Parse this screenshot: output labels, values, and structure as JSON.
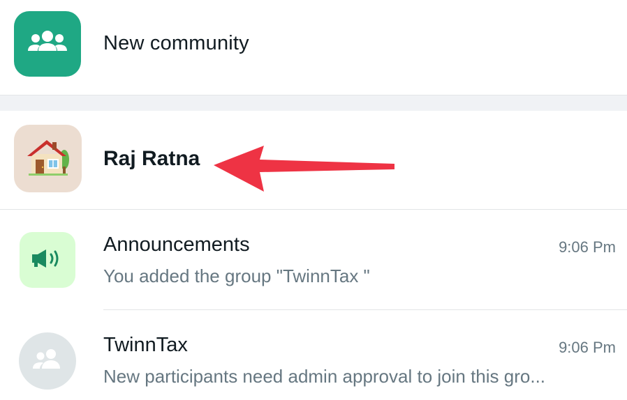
{
  "new_community": {
    "label": "New community",
    "icon": "community-group-icon",
    "tile_color": "#1fa884"
  },
  "community": {
    "name": "Raj Ratna",
    "icon": "house-emoji-icon",
    "tile_color": "#ecddd1",
    "annotation_color": "#ee3344"
  },
  "chats": [
    {
      "name": "Announcements",
      "time": "9:06 Pm",
      "preview": "You added the group \"TwinnTax \"",
      "icon": "megaphone-icon",
      "tile_color": "#d9fdd3"
    },
    {
      "name": "TwinnTax",
      "time": "9:06 Pm",
      "preview": "New participants need admin approval to join this gro...",
      "icon": "group-avatar-icon",
      "tile_color": "#dfe5e7"
    }
  ]
}
